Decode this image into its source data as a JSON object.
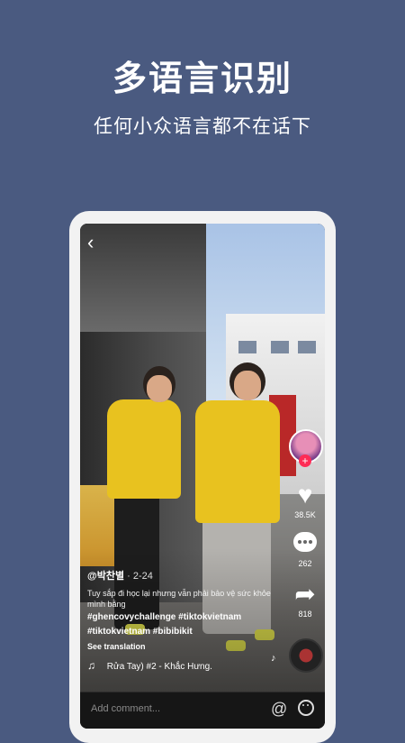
{
  "promo": {
    "headline": "多语言识别",
    "subline": "任何小众语言都不在话下"
  },
  "video": {
    "back_icon": "chevron-left-icon",
    "likes": "38.5K",
    "comments": "262",
    "shares": "818",
    "username": "@박찬별",
    "date": "· 2-24",
    "caption_text": "Tuy sắp đi học lại nhưng vẫn phải bảo vệ sức khỏe mình bằng",
    "hashtags_line1": "#ghencovychallenge #tiktokvietnam",
    "hashtags_line2": "#tiktokvietnam #bibibikit",
    "see_translation": "See translation",
    "music": "Rửa Tay) #2 - Khắc Hưng.",
    "comment_placeholder": "Add comment..."
  },
  "colors": {
    "background": "#4a5a80",
    "accent": "#fe2c55",
    "shirt": "#e8c21f"
  }
}
